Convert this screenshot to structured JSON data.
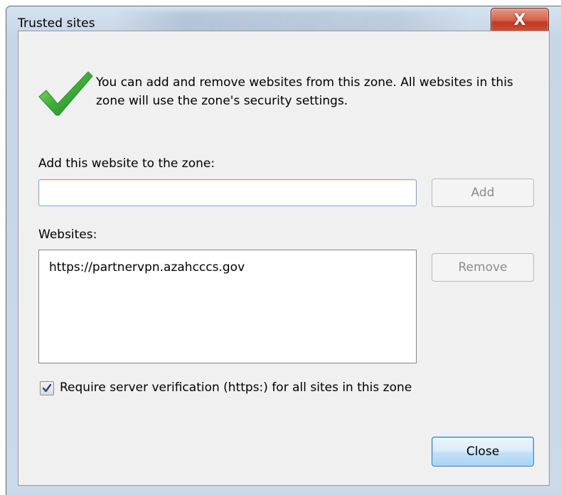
{
  "window": {
    "title": "Trusted sites",
    "close_glyph": "X"
  },
  "intro_text": "You can add and remove websites from this zone. All websites in this zone will use the zone's security settings.",
  "add_section": {
    "label": "Add this website to the zone:",
    "input_value": "",
    "add_button": "Add"
  },
  "websites_section": {
    "label": "Websites:",
    "items": [
      "https://partnervpn.azahcccs.gov"
    ],
    "remove_button": "Remove"
  },
  "require_verification": {
    "label": "Require server verification (https:) for all sites in this zone",
    "checked": true
  },
  "footer": {
    "close_button": "Close"
  },
  "icons": {
    "status": "checkmark-icon",
    "title_close": "close-icon"
  },
  "colors": {
    "checkmark_green": "#3fae3a",
    "close_button_red": "#c94a32",
    "default_button_blue": "#a9d4f4"
  }
}
